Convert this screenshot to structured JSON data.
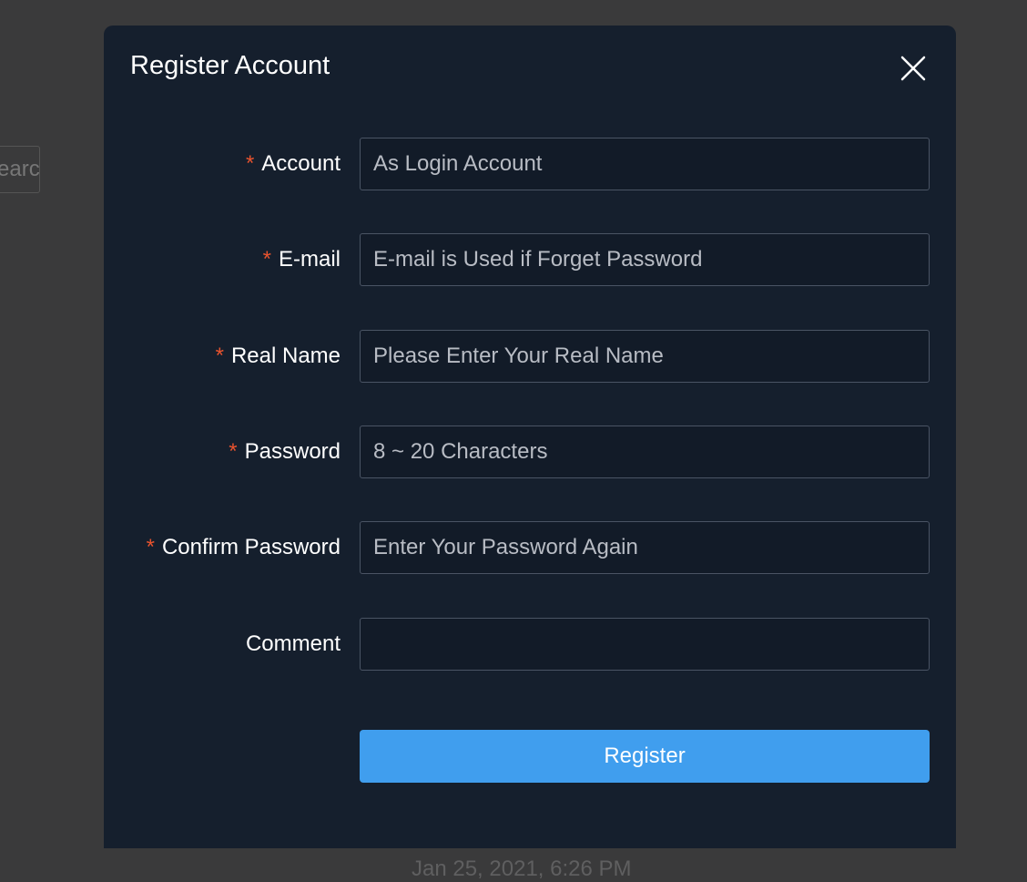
{
  "background": {
    "search_label": "Search",
    "timestamp": "Jan 25, 2021, 6:26 PM"
  },
  "modal": {
    "title": "Register Account",
    "close_icon": "close-icon",
    "required_marker": "*",
    "fields": [
      {
        "label": "Account",
        "required": true,
        "placeholder": "As Login Account",
        "value": ""
      },
      {
        "label": "E-mail",
        "required": true,
        "placeholder": "E-mail is Used if Forget Password",
        "value": ""
      },
      {
        "label": "Real Name",
        "required": true,
        "placeholder": "Please Enter Your Real Name",
        "value": ""
      },
      {
        "label": "Password",
        "required": true,
        "placeholder": "8 ~ 20 Characters",
        "value": ""
      },
      {
        "label": "Confirm Password",
        "required": true,
        "placeholder": "Enter Your Password Again",
        "value": ""
      },
      {
        "label": "Comment",
        "required": false,
        "placeholder": "",
        "value": ""
      }
    ],
    "submit_label": "Register"
  },
  "colors": {
    "overlay": "#3a3a3b",
    "modal_bg": "#151f2d",
    "input_bg": "#121b28",
    "input_border": "#4a5464",
    "required": "#e8532e",
    "primary": "#409eee"
  }
}
